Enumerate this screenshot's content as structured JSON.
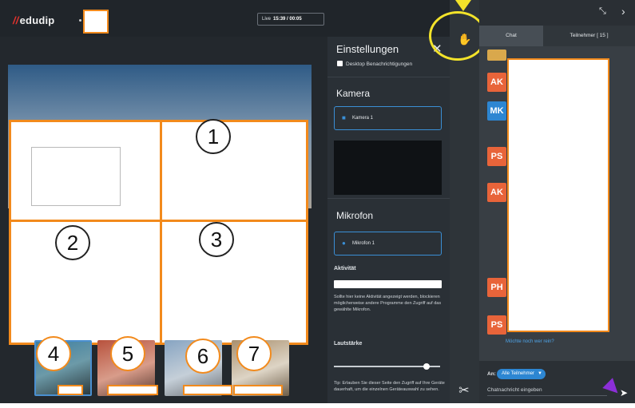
{
  "header": {
    "logo_mark": "//",
    "logo_text": "edudip",
    "live_label": "Live",
    "live_time": "15:39 / 00:05"
  },
  "annotations": {
    "numbers": [
      "1",
      "2",
      "3",
      "4",
      "5",
      "6",
      "7"
    ],
    "highlight_color": "#f3e32a",
    "frame_color": "#f28a1c"
  },
  "settings": {
    "title": "Einstellungen",
    "desktop_notifications_label": "Desktop Benachrichtigungen",
    "camera_section": "Kamera",
    "camera_device": "Kamera 1",
    "microphone_section": "Mikrofon",
    "microphone_device": "Mikrofon 1",
    "activity_label": "Aktivität",
    "activity_help": "Sollte hier keine Aktivität angezeigt werden, blockieren möglicherweise andere Programme den Zugriff auf das gewählte Mikrofon.",
    "volume_label": "Lautstärke",
    "tip_text": "Tip: Erlauben Sie dieser Seite den Zugriff auf Ihre Geräte dauerhaft, um die einzelnen Geräteauswahl zu sehen."
  },
  "tabs": {
    "chat": "Chat",
    "participants": "Teilnehmer [ 15 ]"
  },
  "chat": {
    "avatars": [
      "AK",
      "MK",
      "PS",
      "AK",
      "PH",
      "PS"
    ],
    "more_link": "Möchte noch wer rein?",
    "to_label": "An:",
    "recipient": "Alle Teilnehmer",
    "input_placeholder": "Chatnachricht eingeben"
  },
  "colors": {
    "accent_blue": "#2d86d2",
    "avatar_orange": "#e8643a"
  }
}
